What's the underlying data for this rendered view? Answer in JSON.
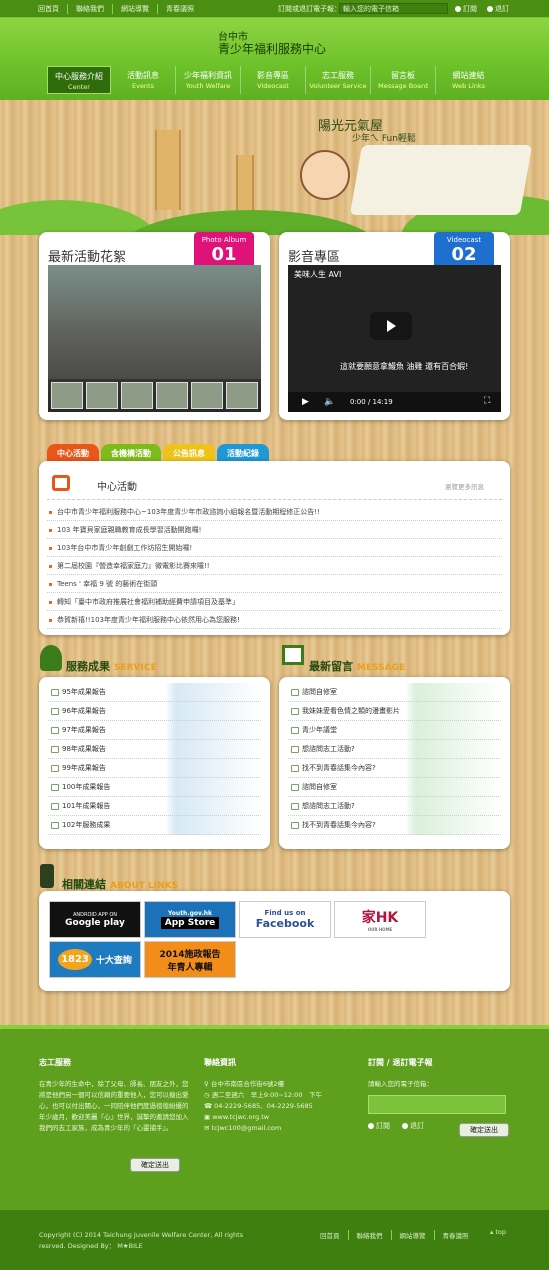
{
  "topbar": {
    "links": [
      "回首頁",
      "聯絡我們",
      "網站導覽",
      "青春議照"
    ],
    "subscribe_label": "訂閱或退訂電子報：",
    "subscribe_placeholder": "輸入您的電子信箱",
    "radio_subscribe": "訂閱",
    "radio_unsubscribe": "退訂"
  },
  "header": {
    "logo_line1": "台中市",
    "logo_line2": "青少年福利服務中心",
    "nav": [
      {
        "zh": "中心服務介紹",
        "en": "Center"
      },
      {
        "zh": "活動訊息",
        "en": "Events"
      },
      {
        "zh": "少年福利資訊",
        "en": "Youth Welfare"
      },
      {
        "zh": "影音專區",
        "en": "Videocast"
      },
      {
        "zh": "志工服務",
        "en": "Volunteer Service"
      },
      {
        "zh": "留言板",
        "en": "Message Board"
      },
      {
        "zh": "網站連結",
        "en": "Web Links"
      }
    ]
  },
  "banner": {
    "slogan": "陽光元氣屋",
    "subslogan": "少年ㄟ Fun輕鬆"
  },
  "photo_album": {
    "title": "最新活動花絮",
    "tag_en": "Photo Album",
    "tag_no": "01"
  },
  "videocast": {
    "title": "影音專區",
    "tag_en": "Videocast",
    "tag_no": "02",
    "video_title": "美味人生 AVI",
    "caption": "這就要願意拿鰻魚 油雞 還有百合蝦!",
    "time": "0:00 / 14:19"
  },
  "tabs": [
    "中心活動",
    "含機構活動",
    "公告訊息",
    "活動紀錄"
  ],
  "news": {
    "heading": "中心活動",
    "more": "瀏覽更多訊息",
    "items": [
      "台中市青少年福利服務中心~103年度青少年市政諮詢小組報名暨活動期程修正公告!!",
      "103 年寶貝家庭親職教育成長學習活動開跑囉!",
      "103年台中市青少年創劇工作坊招生開始囉!",
      "第二屆校園『營造幸福家庭力』微電影比賽來囉!!",
      "Teens ' 幸福 9 號 的藝術在街頭",
      "轉知「臺中市政府推展社會福利補助經費申請項目及基準」",
      "恭賀新禧!!103年度青少年福利服務中心依然用心為您服務!"
    ]
  },
  "service": {
    "heading": "服務成果",
    "heading_en": "SERVICE",
    "items": [
      "95年成果報告",
      "96年成果報告",
      "97年成果報告",
      "98年成果報告",
      "99年成果報告",
      "100年成果報告",
      "101年成果報告",
      "102年服務成果"
    ]
  },
  "message": {
    "heading": "最新留言",
    "heading_en": "MESSAGE",
    "items": [
      "諮問自修室",
      "我妹妹愛看色情之類的漫畫影片",
      "青少年議堂",
      "想諮問志工活動?",
      "找不到青春話集今內容?",
      "諮問自修室",
      "想諮問志工活動?",
      "找不到青春話集今內容?"
    ]
  },
  "links": {
    "heading": "相關連結",
    "heading_en": "ABOUT LINKS",
    "items": [
      {
        "top": "ANDROID APP ON",
        "main": "Google play"
      },
      {
        "top": "Youth.gov.hk",
        "main": "App Store"
      },
      {
        "top": "Find us on",
        "main": "Facebook"
      },
      {
        "top": "家HK",
        "main": "OUR HOME"
      },
      {
        "top": "1823",
        "main": "十大查詢"
      },
      {
        "top": "2014施政報告",
        "main": "年青人專輯"
      }
    ]
  },
  "footer": {
    "volunteer_title": "志工服務",
    "volunteer_text": "在青少年的生命中，除了父母、師長、朋友之外，您將是他們另一個可以信賴的重要他人，您可以撥出愛心，也可以付出關心，一同陪伴他們度過徬徨紛擾的年少歲月，歡迎美麗『心』世界，誠摯的邀請您加入我們的志工家族，成為青少年的『心靈捕手』。",
    "volunteer_btn": "確定送出",
    "contact_title": "聯絡資訊",
    "contact": [
      "台中市南區合作街6號2樓",
      "週二至週六　早上9:00~12:00　下午",
      "04-2229-5685、04-2229-5685",
      "www.tcjwc.org.tw",
      "tcjwc100@gmail.com"
    ],
    "epaper_title": "訂閱 / 退訂電子報",
    "epaper_label": "請輸入您的電子信箱：",
    "epaper_sub": "訂閱",
    "epaper_unsub": "退訂",
    "epaper_btn": "確定送出"
  },
  "bottom": {
    "copyright": "Copyright (C) 2014 Taichung Juvenile Welfare Center,   All rights resrved.   Designed By： M★BILE",
    "links": [
      "回首頁",
      "聯絡我們",
      "網站導覽",
      "青春議照"
    ],
    "top": "top"
  }
}
